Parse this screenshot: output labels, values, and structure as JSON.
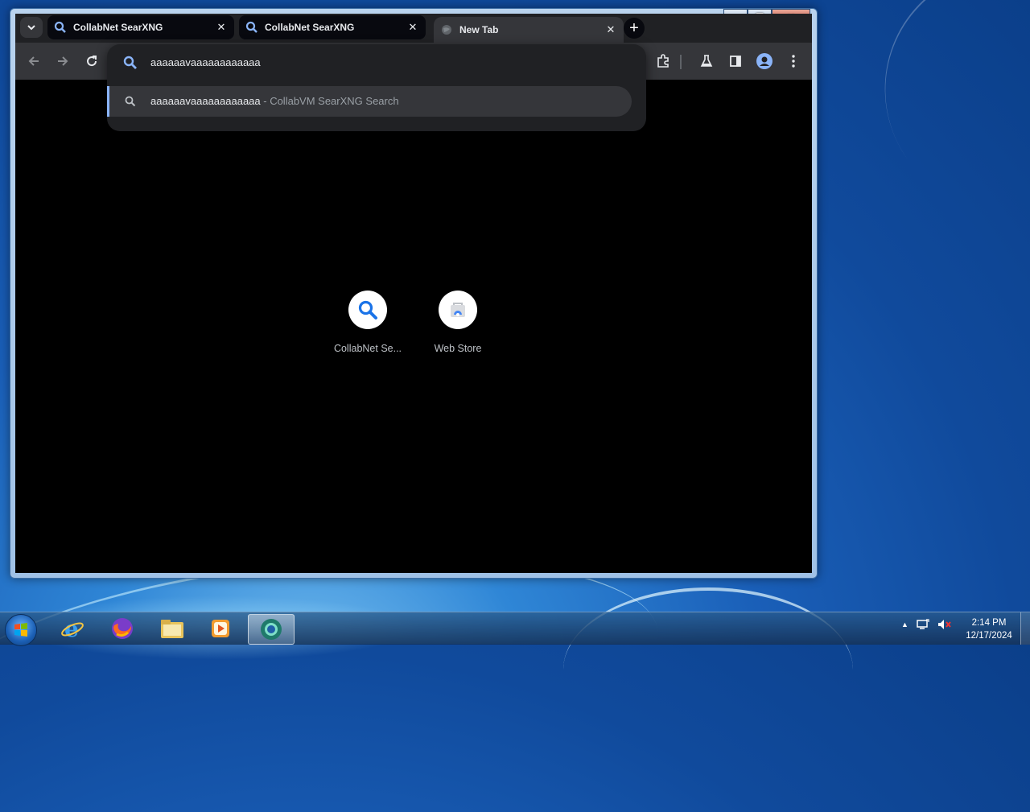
{
  "browser": {
    "tabs": [
      {
        "label": "CollabNet SearXNG",
        "icon": "search-icon",
        "active": false
      },
      {
        "label": "CollabNet SearXNG",
        "icon": "search-icon",
        "active": false
      },
      {
        "label": "New Tab",
        "icon": "globe-icon",
        "active": true
      }
    ],
    "new_tab_label": "+",
    "close_glyph": "✕"
  },
  "omnibox": {
    "value": "aaaaaavaaaaaaaaaaaa",
    "suggestion": {
      "query": "aaaaaavaaaaaaaaaaaa",
      "description": " - CollabVM SearXNG Search"
    }
  },
  "new_tab_page": {
    "shortcuts": [
      {
        "label": "CollabNet Se...",
        "icon": "search-icon"
      },
      {
        "label": "Web Store",
        "icon": "web-store-icon"
      }
    ]
  },
  "taskbar": {
    "clock_time": "2:14 PM",
    "clock_date": "12/17/2024",
    "items": [
      "start-orb",
      "internet-explorer",
      "firefox",
      "file-explorer",
      "media-player",
      "chrome"
    ]
  },
  "colors": {
    "accent": "#8ab4f8",
    "toolbar": "#35363a",
    "frame": "#202124",
    "search_blue": "#1a73e8"
  }
}
